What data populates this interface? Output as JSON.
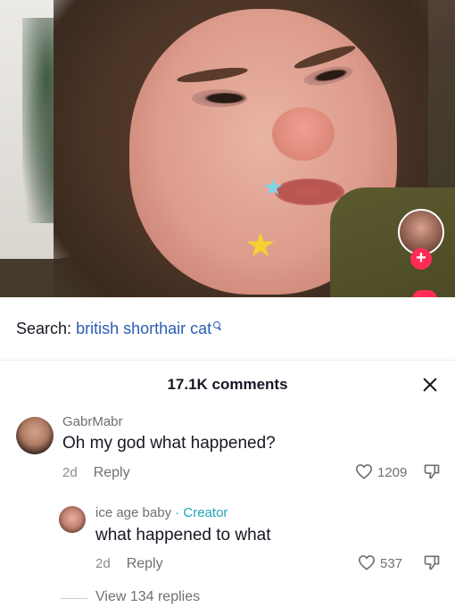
{
  "video": {
    "profile_avatar": "creator-avatar",
    "follow_icon": "plus-icon"
  },
  "search": {
    "prefix": "Search:",
    "query": "british shorthair cat",
    "icon": "search-icon"
  },
  "comments_header": {
    "count_label": "17.1K comments",
    "close_icon": "close-icon"
  },
  "comments": [
    {
      "username": "GabrMabr",
      "text": "Oh my god what happened?",
      "age": "2d",
      "reply_label": "Reply",
      "likes": "1209"
    },
    {
      "username": "ice age baby",
      "badge": "· Creator",
      "text": "what happened to what",
      "age": "2d",
      "reply_label": "Reply",
      "likes": "537"
    }
  ],
  "view_replies_label": "View 134 replies",
  "colors": {
    "accent": "#fe2c55",
    "search_query": "#2b5db4",
    "creator_badge": "#20a7b8"
  }
}
